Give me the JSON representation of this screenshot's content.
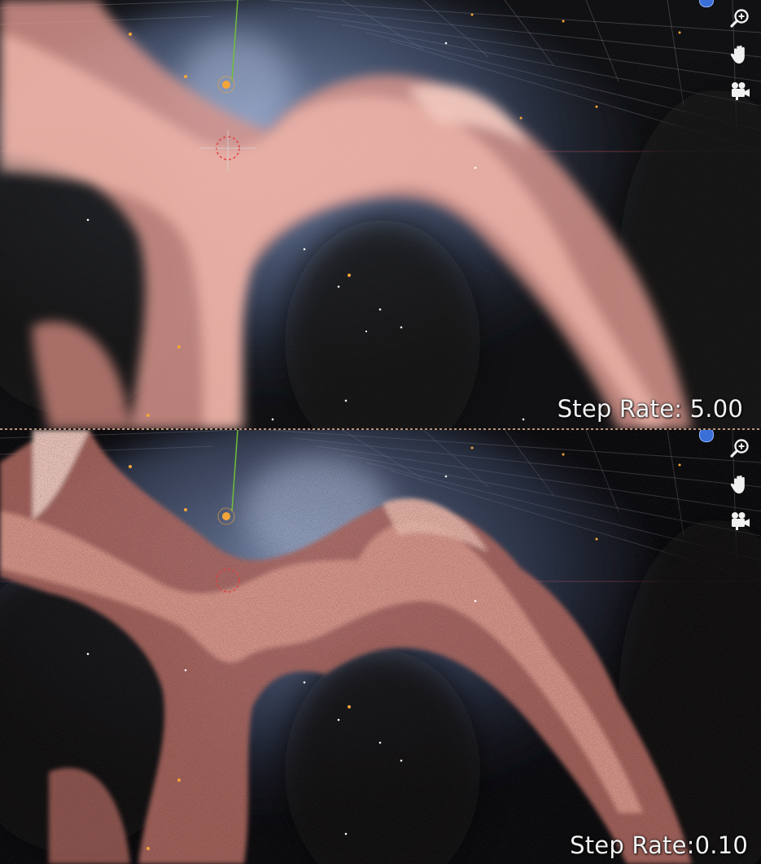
{
  "viewports": [
    {
      "id": "top",
      "step_label": "Step Rate: 5.00",
      "density_style": "smooth"
    },
    {
      "id": "bottom",
      "step_label": "Step Rate:0.10",
      "density_style": "grainy"
    }
  ],
  "nav_tools": [
    {
      "name": "zoom",
      "icon": "zoom-icon"
    },
    {
      "name": "pan",
      "icon": "hand-icon"
    },
    {
      "name": "camera",
      "icon": "camera-icon"
    }
  ],
  "colors": {
    "background": "#06070a",
    "cloud_pink": "#e7a59a",
    "cloud_shadow": "#9a5a54",
    "haze_blue": "#6f86b3",
    "star_orange": "#f4a53a",
    "axis_green": "#6fbf3a",
    "grid_line": "#7d7d82"
  }
}
